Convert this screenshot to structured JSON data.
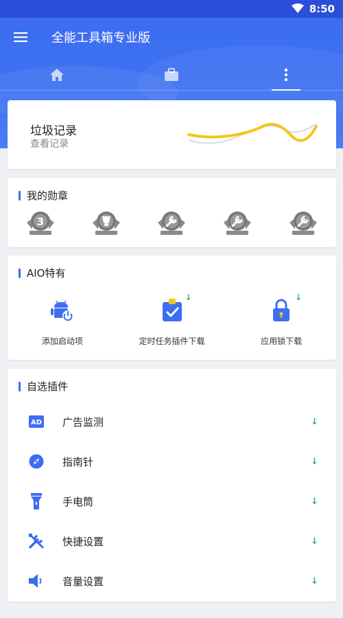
{
  "status": {
    "time": "8:50"
  },
  "app": {
    "title": "全能工具箱专业版"
  },
  "tabs": [
    {
      "icon": "home-icon"
    },
    {
      "icon": "briefcase-icon"
    },
    {
      "icon": "more-vert-icon",
      "active": true
    }
  ],
  "trash": {
    "title": "垃圾记录",
    "subtitle": "查看记录"
  },
  "badges": {
    "title": "我的勋章",
    "items": [
      "3",
      "",
      "",
      "",
      ""
    ]
  },
  "aio": {
    "title": "AIO特有",
    "items": [
      {
        "label": "添加启动项",
        "icon": "android-power-icon",
        "download": false
      },
      {
        "label": "定时任务插件下载",
        "icon": "clipboard-check-icon",
        "download": true
      },
      {
        "label": "应用锁下载",
        "icon": "padlock-icon",
        "download": true
      }
    ]
  },
  "plugins": {
    "title": "自选插件",
    "items": [
      {
        "label": "广告监测",
        "icon": "ad-icon"
      },
      {
        "label": "指南针",
        "icon": "compass-icon"
      },
      {
        "label": "手电筒",
        "icon": "flashlight-icon"
      },
      {
        "label": "快捷设置",
        "icon": "tools-icon"
      },
      {
        "label": "音量设置",
        "icon": "speaker-icon"
      }
    ],
    "download_arrow": "↓"
  },
  "colors": {
    "primary": "#3d6ef2",
    "download": "#2fb36b",
    "wave": "#f5c518"
  }
}
